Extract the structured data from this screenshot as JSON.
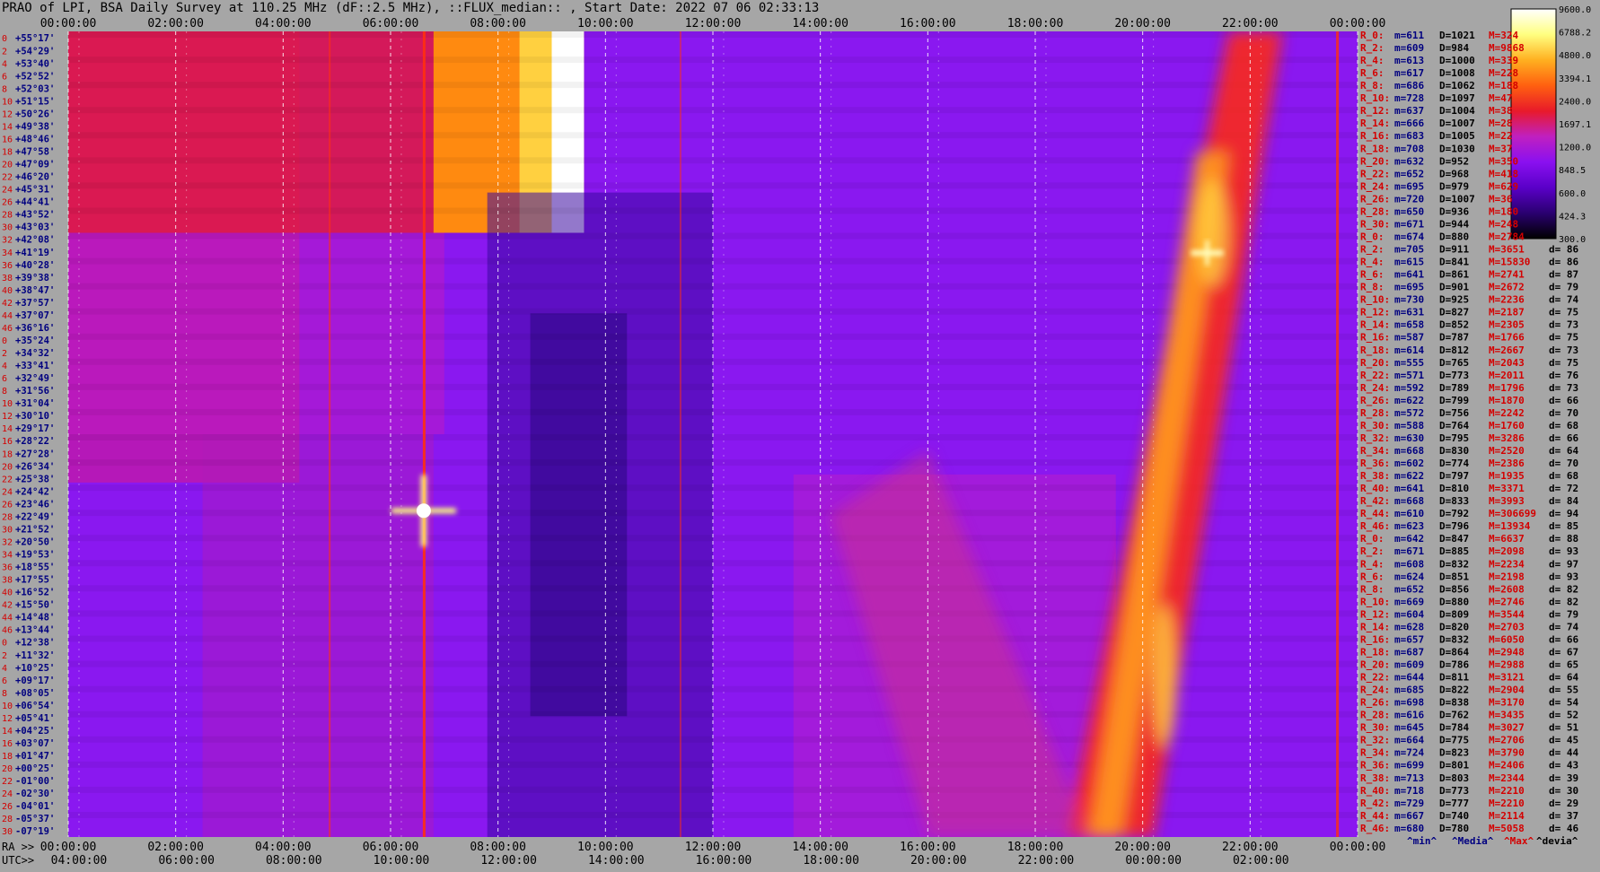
{
  "title": "PRAO of LPI, BSA Daily Survey at 110.25 MHz (dF::2.5 MHz), ::FLUX_median:: , Start Date: 2022 07 06 02:33:13",
  "chart_data": {
    "type": "heatmap",
    "title": "PRAO of LPI, BSA Daily Survey at 110.25 MHz (dF::2.5 MHz), ::FLUX_median:: , Start Date: 2022 07 06 02:33:13",
    "top_time_ticks": [
      "00:00:00",
      "02:00:00",
      "04:00:00",
      "06:00:00",
      "08:00:00",
      "10:00:00",
      "12:00:00",
      "14:00:00",
      "16:00:00",
      "18:00:00",
      "20:00:00",
      "22:00:00",
      "00:00:00"
    ],
    "ra_ticks": [
      "00:00:00",
      "02:00:00",
      "04:00:00",
      "06:00:00",
      "08:00:00",
      "10:00:00",
      "12:00:00",
      "14:00:00",
      "16:00:00",
      "18:00:00",
      "20:00:00",
      "22:00:00",
      "00:00:00"
    ],
    "utc_ticks": [
      "04:00:00",
      "06:00:00",
      "08:00:00",
      "10:00:00",
      "12:00:00",
      "14:00:00",
      "16:00:00",
      "18:00:00",
      "20:00:00",
      "22:00:00",
      "00:00:00",
      "02:00:00"
    ],
    "bottom_prefix_ra": "RA >>",
    "bottom_prefix_utc": "UTC>>",
    "dec_labels": [
      "+55°17'",
      "+54°29'",
      "+53°40'",
      "+52°52'",
      "+52°03'",
      "+51°15'",
      "+50°26'",
      "+49°38'",
      "+48°46'",
      "+47°58'",
      "+47°09'",
      "+46°20'",
      "+45°31'",
      "+44°41'",
      "+43°52'",
      "+43°03'",
      "+42°08'",
      "+41°19'",
      "+40°28'",
      "+39°38'",
      "+38°47'",
      "+37°57'",
      "+37°07'",
      "+36°16'",
      "+35°24'",
      "+34°32'",
      "+33°41'",
      "+32°49'",
      "+31°56'",
      "+31°04'",
      "+30°10'",
      "+29°17'",
      "+28°22'",
      "+27°28'",
      "+26°34'",
      "+25°38'",
      "+24°42'",
      "+23°46'",
      "+22°49'",
      "+21°52'",
      "+20°50'",
      "+19°53'",
      "+18°55'",
      "+17°55'",
      "+16°52'",
      "+15°50'",
      "+14°48'",
      "+13°44'",
      "+12°38'",
      "+11°32'",
      "+10°25'",
      "+09°17'",
      "+08°05'",
      "+06°54'",
      "+05°41'",
      "+04°25'",
      "+03°07'",
      "+01°47'",
      "+00°25'",
      "-01°00'",
      "-02°30'",
      "-04°01'",
      "-05°37'",
      "-07°19'"
    ],
    "colorbar_ticks": [
      "9600.0",
      "6788.2",
      "4800.0",
      "3394.1",
      "2400.0",
      "1697.1",
      "1200.0",
      "848.5",
      "600.0",
      "424.3",
      "300.0"
    ],
    "colorbar_range": [
      300,
      9600
    ],
    "colorbar_scale": "log",
    "colormap": [
      "#000000",
      "#2a0070",
      "#5a00c8",
      "#8a10f0",
      "#c020c0",
      "#e81a2a",
      "#ff6010",
      "#ffb020",
      "#ffff80",
      "#ffffff"
    ],
    "stats_rows": [
      {
        "label": "R_0:",
        "min": "m=611",
        "median": "D=1021",
        "max": "M=324",
        "dev": ""
      },
      {
        "label": "R_2:",
        "min": "m=609",
        "median": "D=984",
        "max": "M=9868",
        "dev": ""
      },
      {
        "label": "R_4:",
        "min": "m=613",
        "median": "D=1000",
        "max": "M=339",
        "dev": ""
      },
      {
        "label": "R_6:",
        "min": "m=617",
        "median": "D=1008",
        "max": "M=228",
        "dev": ""
      },
      {
        "label": "R_8:",
        "min": "m=686",
        "median": "D=1062",
        "max": "M=188",
        "dev": ""
      },
      {
        "label": "R_10:",
        "min": "m=728",
        "median": "D=1097",
        "max": "M=47",
        "dev": ""
      },
      {
        "label": "R_12:",
        "min": "m=637",
        "median": "D=1004",
        "max": "M=38",
        "dev": ""
      },
      {
        "label": "R_14:",
        "min": "m=666",
        "median": "D=1007",
        "max": "M=28",
        "dev": ""
      },
      {
        "label": "R_16:",
        "min": "m=683",
        "median": "D=1005",
        "max": "M=22",
        "dev": ""
      },
      {
        "label": "R_18:",
        "min": "m=708",
        "median": "D=1030",
        "max": "M=37",
        "dev": ""
      },
      {
        "label": "R_20:",
        "min": "m=632",
        "median": "D=952",
        "max": "M=350",
        "dev": ""
      },
      {
        "label": "R_22:",
        "min": "m=652",
        "median": "D=968",
        "max": "M=418",
        "dev": ""
      },
      {
        "label": "R_24:",
        "min": "m=695",
        "median": "D=979",
        "max": "M=629",
        "dev": ""
      },
      {
        "label": "R_26:",
        "min": "m=720",
        "median": "D=1007",
        "max": "M=36",
        "dev": ""
      },
      {
        "label": "R_28:",
        "min": "m=650",
        "median": "D=936",
        "max": "M=180",
        "dev": ""
      },
      {
        "label": "R_30:",
        "min": "m=671",
        "median": "D=944",
        "max": "M=248",
        "dev": ""
      },
      {
        "label": "R_0:",
        "min": "m=674",
        "median": "D=880",
        "max": "M=2784",
        "dev": ""
      },
      {
        "label": "R_2:",
        "min": "m=705",
        "median": "D=911",
        "max": "M=3651",
        "dev": "d= 86"
      },
      {
        "label": "R_4:",
        "min": "m=615",
        "median": "D=841",
        "max": "M=15830",
        "dev": "d= 86"
      },
      {
        "label": "R_6:",
        "min": "m=641",
        "median": "D=861",
        "max": "M=2741",
        "dev": "d= 87"
      },
      {
        "label": "R_8:",
        "min": "m=695",
        "median": "D=901",
        "max": "M=2672",
        "dev": "d= 79"
      },
      {
        "label": "R_10:",
        "min": "m=730",
        "median": "D=925",
        "max": "M=2236",
        "dev": "d= 74"
      },
      {
        "label": "R_12:",
        "min": "m=631",
        "median": "D=827",
        "max": "M=2187",
        "dev": "d= 75"
      },
      {
        "label": "R_14:",
        "min": "m=658",
        "median": "D=852",
        "max": "M=2305",
        "dev": "d= 73"
      },
      {
        "label": "R_16:",
        "min": "m=587",
        "median": "D=787",
        "max": "M=1766",
        "dev": "d= 75"
      },
      {
        "label": "R_18:",
        "min": "m=614",
        "median": "D=812",
        "max": "M=2667",
        "dev": "d= 73"
      },
      {
        "label": "R_20:",
        "min": "m=555",
        "median": "D=765",
        "max": "M=2043",
        "dev": "d= 75"
      },
      {
        "label": "R_22:",
        "min": "m=571",
        "median": "D=773",
        "max": "M=2011",
        "dev": "d= 76"
      },
      {
        "label": "R_24:",
        "min": "m=592",
        "median": "D=789",
        "max": "M=1796",
        "dev": "d= 73"
      },
      {
        "label": "R_26:",
        "min": "m=622",
        "median": "D=799",
        "max": "M=1870",
        "dev": "d= 66"
      },
      {
        "label": "R_28:",
        "min": "m=572",
        "median": "D=756",
        "max": "M=2242",
        "dev": "d= 70"
      },
      {
        "label": "R_30:",
        "min": "m=588",
        "median": "D=764",
        "max": "M=1760",
        "dev": "d= 68"
      },
      {
        "label": "R_32:",
        "min": "m=630",
        "median": "D=795",
        "max": "M=3286",
        "dev": "d= 66"
      },
      {
        "label": "R_34:",
        "min": "m=668",
        "median": "D=830",
        "max": "M=2520",
        "dev": "d= 64"
      },
      {
        "label": "R_36:",
        "min": "m=602",
        "median": "D=774",
        "max": "M=2386",
        "dev": "d= 70"
      },
      {
        "label": "R_38:",
        "min": "m=622",
        "median": "D=797",
        "max": "M=1935",
        "dev": "d= 68"
      },
      {
        "label": "R_40:",
        "min": "m=641",
        "median": "D=810",
        "max": "M=3371",
        "dev": "d= 72"
      },
      {
        "label": "R_42:",
        "min": "m=668",
        "median": "D=833",
        "max": "M=3993",
        "dev": "d= 84"
      },
      {
        "label": "R_44:",
        "min": "m=610",
        "median": "D=792",
        "max": "M=306699",
        "dev": "d= 94"
      },
      {
        "label": "R_46:",
        "min": "m=623",
        "median": "D=796",
        "max": "M=13934",
        "dev": "d= 85"
      },
      {
        "label": "R_0:",
        "min": "m=642",
        "median": "D=847",
        "max": "M=6637",
        "dev": "d= 88"
      },
      {
        "label": "R_2:",
        "min": "m=671",
        "median": "D=885",
        "max": "M=2098",
        "dev": "d= 93"
      },
      {
        "label": "R_4:",
        "min": "m=608",
        "median": "D=832",
        "max": "M=2234",
        "dev": "d= 97"
      },
      {
        "label": "R_6:",
        "min": "m=624",
        "median": "D=851",
        "max": "M=2198",
        "dev": "d= 93"
      },
      {
        "label": "R_8:",
        "min": "m=652",
        "median": "D=856",
        "max": "M=2608",
        "dev": "d= 82"
      },
      {
        "label": "R_10:",
        "min": "m=669",
        "median": "D=880",
        "max": "M=2746",
        "dev": "d= 82"
      },
      {
        "label": "R_12:",
        "min": "m=604",
        "median": "D=809",
        "max": "M=3544",
        "dev": "d= 79"
      },
      {
        "label": "R_14:",
        "min": "m=628",
        "median": "D=820",
        "max": "M=2703",
        "dev": "d= 74"
      },
      {
        "label": "R_16:",
        "min": "m=657",
        "median": "D=832",
        "max": "M=6050",
        "dev": "d= 66"
      },
      {
        "label": "R_18:",
        "min": "m=687",
        "median": "D=864",
        "max": "M=2948",
        "dev": "d= 67"
      },
      {
        "label": "R_20:",
        "min": "m=609",
        "median": "D=786",
        "max": "M=2988",
        "dev": "d= 65"
      },
      {
        "label": "R_22:",
        "min": "m=644",
        "median": "D=811",
        "max": "M=3121",
        "dev": "d= 64"
      },
      {
        "label": "R_24:",
        "min": "m=685",
        "median": "D=822",
        "max": "M=2904",
        "dev": "d= 55"
      },
      {
        "label": "R_26:",
        "min": "m=698",
        "median": "D=838",
        "max": "M=3170",
        "dev": "d= 54"
      },
      {
        "label": "R_28:",
        "min": "m=616",
        "median": "D=762",
        "max": "M=3435",
        "dev": "d= 52"
      },
      {
        "label": "R_30:",
        "min": "m=645",
        "median": "D=784",
        "max": "M=3027",
        "dev": "d= 51"
      },
      {
        "label": "R_32:",
        "min": "m=664",
        "median": "D=775",
        "max": "M=2706",
        "dev": "d= 45"
      },
      {
        "label": "R_34:",
        "min": "m=724",
        "median": "D=823",
        "max": "M=3790",
        "dev": "d= 44"
      },
      {
        "label": "R_36:",
        "min": "m=699",
        "median": "D=801",
        "max": "M=2406",
        "dev": "d= 43"
      },
      {
        "label": "R_38:",
        "min": "m=713",
        "median": "D=803",
        "max": "M=2344",
        "dev": "d= 39"
      },
      {
        "label": "R_40:",
        "min": "m=718",
        "median": "D=773",
        "max": "M=2210",
        "dev": "d= 30"
      },
      {
        "label": "R_42:",
        "min": "m=729",
        "median": "D=777",
        "max": "M=2210",
        "dev": "d= 29"
      },
      {
        "label": "R_44:",
        "min": "m=667",
        "median": "D=740",
        "max": "M=2114",
        "dev": "d= 37"
      },
      {
        "label": "R_46:",
        "min": "m=680",
        "median": "D=780",
        "max": "M=5058",
        "dev": "d= 46"
      }
    ],
    "legend_footer": [
      "^min^",
      "^Media^",
      "^Max^",
      "^devia^"
    ],
    "colors": {
      "row_label_red": "#d40000",
      "dec_label_navy": "#000080",
      "min_col": "#000080",
      "median_col": "#000000",
      "max_col": "#d40000",
      "background": "#a6a6a6",
      "grid": "#ffffff"
    }
  }
}
